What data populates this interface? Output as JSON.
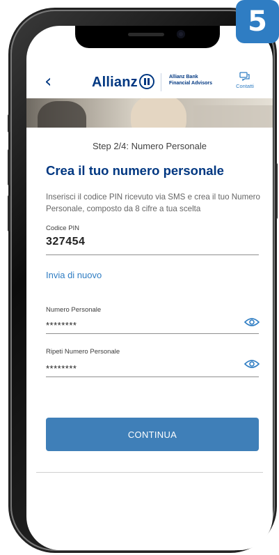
{
  "step_badge": "5",
  "header": {
    "back_symbol": "‹",
    "brand": "Allianz",
    "brand_sub_line1": "Allianz Bank",
    "brand_sub_line2": "Financial Advisors",
    "contacts_label": "Contatti"
  },
  "form": {
    "step_label": "Step 2/4: Numero Personale",
    "title": "Crea il tuo numero personale",
    "description": "Inserisci il codice PIN ricevuto via SMS e crea il tuo Numero Personale, composto da 8 cifre a tua scelta",
    "pin_label": "Codice PIN",
    "pin_value": "327454",
    "resend_link": "Invia di nuovo",
    "personal_number_label": "Numero Personale",
    "personal_number_value": "********",
    "repeat_label": "Ripeti Numero Personale",
    "repeat_value": "********",
    "continue_button": "CONTINUA"
  },
  "colors": {
    "brand_blue": "#003781",
    "accent_blue": "#2f7dc3",
    "button_blue": "#3f7fb8"
  },
  "icons": [
    "back-arrow-icon",
    "allianz-logo-icon",
    "contacts-chat-icon",
    "eye-icon"
  ]
}
